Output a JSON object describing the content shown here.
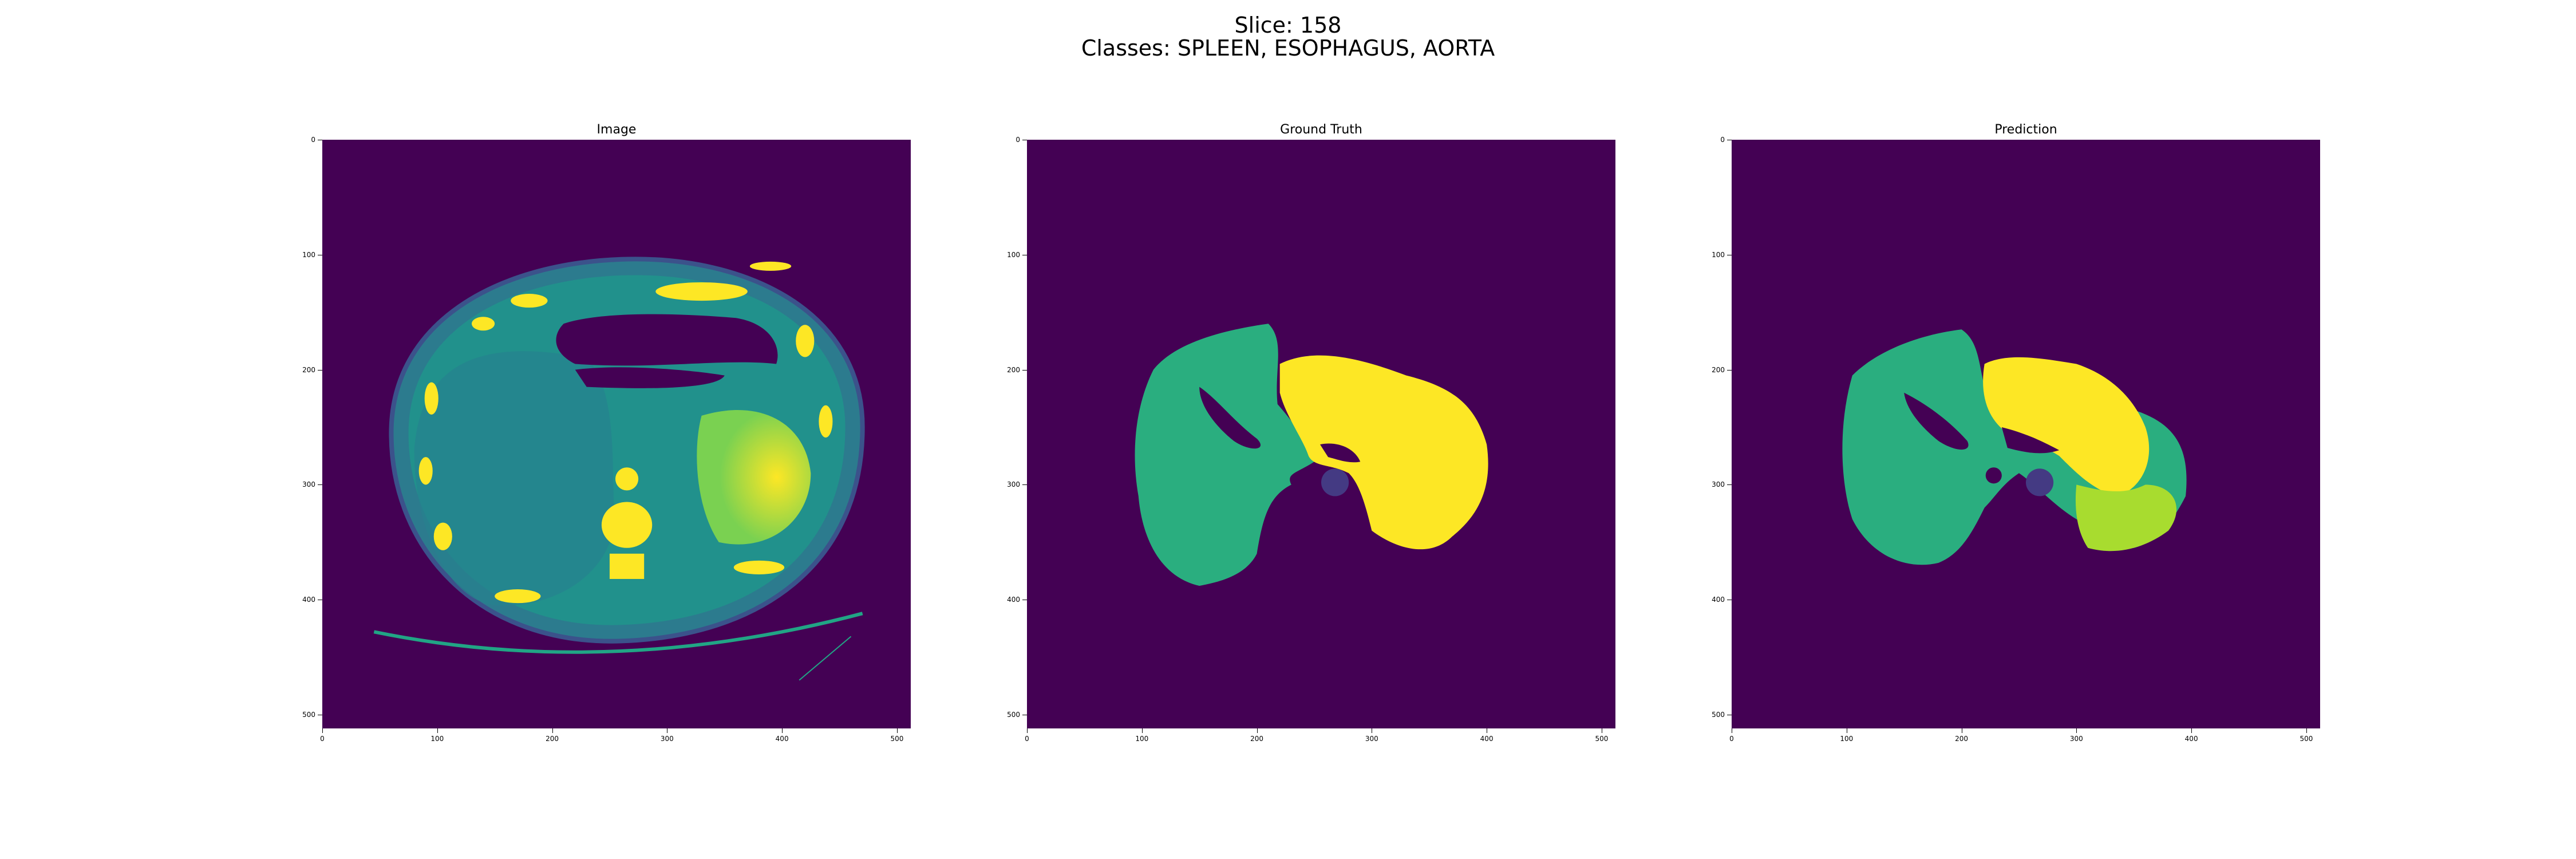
{
  "figure": {
    "slice_line": "Slice: 158",
    "classes_line": "Classes: SPLEEN, ESOPHAGUS, AORTA"
  },
  "panels": [
    {
      "title": "Image"
    },
    {
      "title": "Ground Truth"
    },
    {
      "title": "Prediction"
    }
  ],
  "axis_ticks": {
    "x": [
      "0",
      "100",
      "200",
      "300",
      "400",
      "500"
    ],
    "y": [
      "0",
      "100",
      "200",
      "300",
      "400",
      "500"
    ]
  },
  "colors": {
    "background": "#440154",
    "ct_body": "#21918c",
    "bone": "#fde725",
    "liver_class": "#2aae7f",
    "spleen_class": "#fde725",
    "aorta_class": "#443a83",
    "extra_class": "#a8dc2f"
  }
}
